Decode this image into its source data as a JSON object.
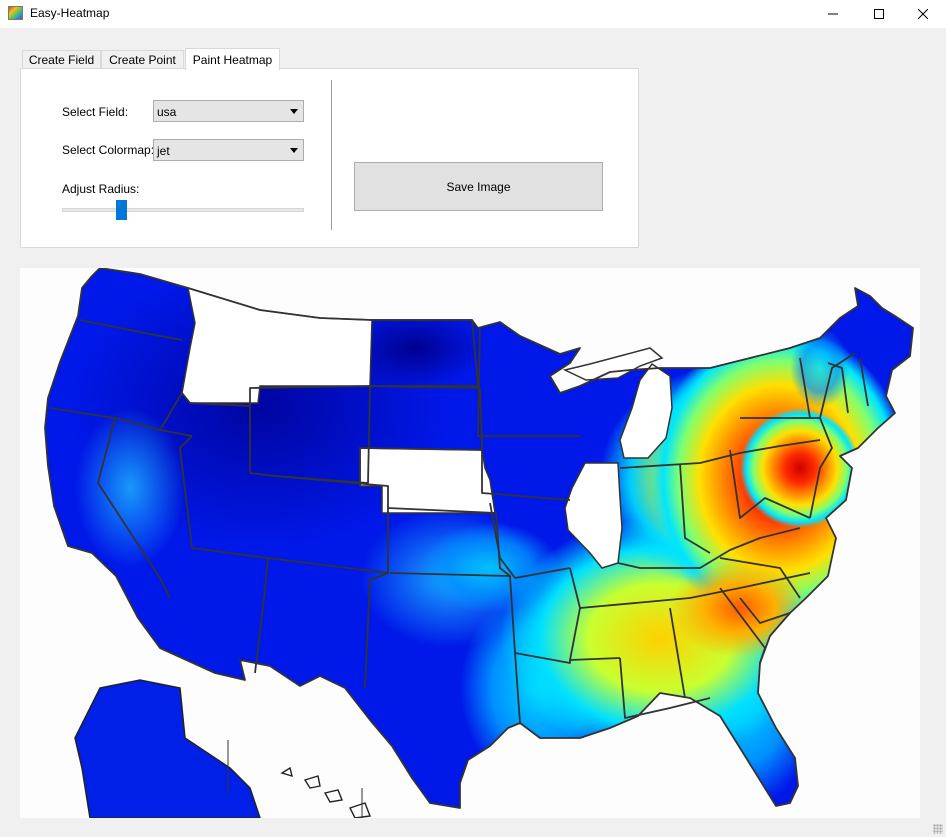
{
  "window": {
    "title": "Easy-Heatmap",
    "controls": [
      "minimize",
      "maximize",
      "close"
    ]
  },
  "tabs": [
    {
      "label": "Create Field",
      "active": false
    },
    {
      "label": "Create Point",
      "active": false
    },
    {
      "label": "Paint Heatmap",
      "active": true
    }
  ],
  "form": {
    "field_label": "Select Field:",
    "field_value": "usa",
    "colormap_label": "Select Colormap:",
    "colormap_value": "jet",
    "radius_label": "Adjust Radius:",
    "radius_fraction": 0.24,
    "save_label": "Save Image"
  },
  "heatmap": {
    "map": "usa",
    "colormap": "jet",
    "hotspot_region": "Mid-Atlantic (Virginia / Maryland / Delaware / New Jersey)",
    "uncolored_states": [
      "Montana",
      "Nebraska",
      "Illinois",
      "Michigan"
    ]
  },
  "colors": {
    "accent": "#0078d7",
    "jet_low": "#00008f",
    "jet_high": "#cc0000"
  }
}
